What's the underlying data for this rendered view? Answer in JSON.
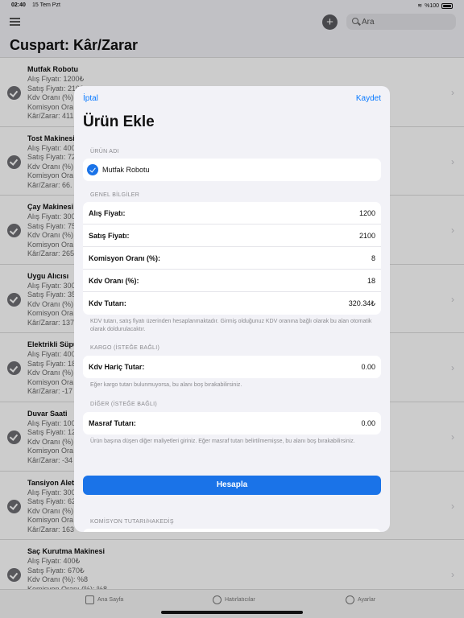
{
  "status": {
    "time": "02:40",
    "date": "15 Tem Pzt",
    "battery": "%100"
  },
  "nav": {
    "search_placeholder": "Ara",
    "add_label": "+"
  },
  "page_title": "Cuspart: Kâr/Zarar",
  "list": [
    {
      "name": "Mutfak Robotu",
      "lines": [
        "Alış Fiyatı: 1200₺",
        "Satış Fiyatı: 2100",
        "Kdv Oranı (%)",
        "Komisyon Ora",
        "Kâr/Zarar: 411"
      ]
    },
    {
      "name": "Tost Makinesi",
      "lines": [
        "Alış Fiyatı: 400",
        "Satış Fiyatı: 72",
        "Kdv Oranı (%)",
        "Komisyon Ora",
        "Kâr/Zarar: 66."
      ]
    },
    {
      "name": "Çay Makinesi",
      "lines": [
        "Alış Fiyatı: 300",
        "Satış Fiyatı: 75",
        "Kdv Oranı (%)",
        "Komisyon Ora",
        "Kâr/Zarar: 265"
      ]
    },
    {
      "name": "Uygu Alıcısı",
      "lines": [
        "Alış Fiyatı: 300",
        "Satış Fiyatı: 35",
        "Kdv Oranı (%)",
        "Komisyon Ora",
        "Kâr/Zarar: 137"
      ]
    },
    {
      "name": "Elektrikli Süpü",
      "lines": [
        "Alış Fiyatı: 400",
        "Satış Fiyatı: 18",
        "Kdv Oranı (%)",
        "Komisyon Ora",
        "Kâr/Zarar: -17"
      ]
    },
    {
      "name": "Duvar Saati",
      "lines": [
        "Alış Fiyatı: 100",
        "Satış Fiyatı: 12",
        "Kdv Oranı (%)",
        "Komisyon Ora",
        "Kâr/Zarar: -34"
      ]
    },
    {
      "name": "Tansiyon Aleti",
      "lines": [
        "Alış Fiyatı: 300",
        "Satış Fiyatı: 62",
        "Kdv Oranı (%)",
        "Komisyon Ora",
        "Kâr/Zarar: 163"
      ]
    },
    {
      "name": "Saç Kurutma Makinesi",
      "lines": [
        "Alış Fiyatı: 400₺",
        "Satış Fiyatı: 670₺",
        "Kdv Oranı (%): %8",
        "Komisyon Oranı (%): %8"
      ]
    }
  ],
  "tabs": [
    "Ana Sayfa",
    "Hatırlatıcılar",
    "Ayarlar"
  ],
  "sheet": {
    "cancel": "İptal",
    "save": "Kaydet",
    "title": "Ürün Ekle",
    "product_header": "ÜRÜN ADI",
    "product_name": "Mutfak Robotu",
    "general_header": "GENEL BİLGİLER",
    "general_rows": [
      {
        "label": "Alış Fiyatı:",
        "value": "1200"
      },
      {
        "label": "Satış Fiyatı:",
        "value": "2100"
      },
      {
        "label": "Komisyon Oranı (%):",
        "value": "8"
      },
      {
        "label": "Kdv Oranı (%):",
        "value": "18"
      },
      {
        "label": "Kdv Tutarı:",
        "value": "320.34₺"
      }
    ],
    "general_footer": "KDV tutarı, satış fiyatı üzerinden hesaplanmaktadır. Girmiş olduğunuz KDV oranına bağlı olarak bu alan otomatik olarak doldurulacaktır.",
    "cargo_header": "KARGO (İSTEĞE BAĞLI)",
    "cargo_label": "Kdv Hariç Tutar:",
    "cargo_value": "0.00",
    "cargo_footer": "Eğer kargo tutarı bulunmuyorsa, bu alanı boş bırakabilirsiniz.",
    "other_header": "DİĞER (İSTEĞE BAĞLI)",
    "other_label": "Masraf Tutarı:",
    "other_value": "0.00",
    "other_footer": "Ürün başına düşen diğer maliyetleri giriniz. Eğer masraf tutarı belirtilmemişse, bu alanı boş bırakabilirsiniz.",
    "calculate": "Hesapla",
    "commission_header": "KOMİSYON TUTARI/HAKEDİŞ"
  }
}
